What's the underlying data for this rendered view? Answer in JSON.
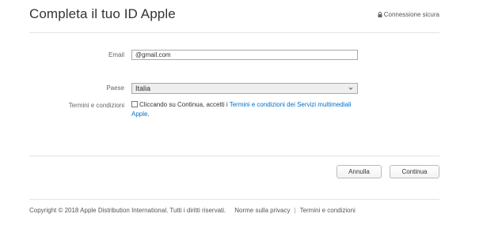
{
  "header": {
    "title": "Completa il tuo ID Apple",
    "secure_label": "Connessione sicura",
    "secure_icon": "lock-icon"
  },
  "form": {
    "email": {
      "label": "Email",
      "value": "@gmail.com"
    },
    "country": {
      "label": "Paese",
      "value": "Italia",
      "icon": "chevron-down-icon"
    },
    "terms": {
      "label": "Termini e condizioni",
      "checked": false,
      "text": "Cliccando su Continua, accetti i ",
      "link_text": "Termini e condizioni dei Servizi multimediali Apple",
      "suffix": "."
    }
  },
  "actions": {
    "cancel_label": "Annulla",
    "continue_label": "Continua"
  },
  "footer": {
    "copyright": "Copyright © 2018 Apple Distribution International. Tutti i diritti riservati.",
    "privacy": "Norme sulla privacy",
    "separator": "|",
    "terms": "Termini e condizioni"
  },
  "colors": {
    "link": "#0070c9",
    "divider": "#e3e3e3"
  }
}
